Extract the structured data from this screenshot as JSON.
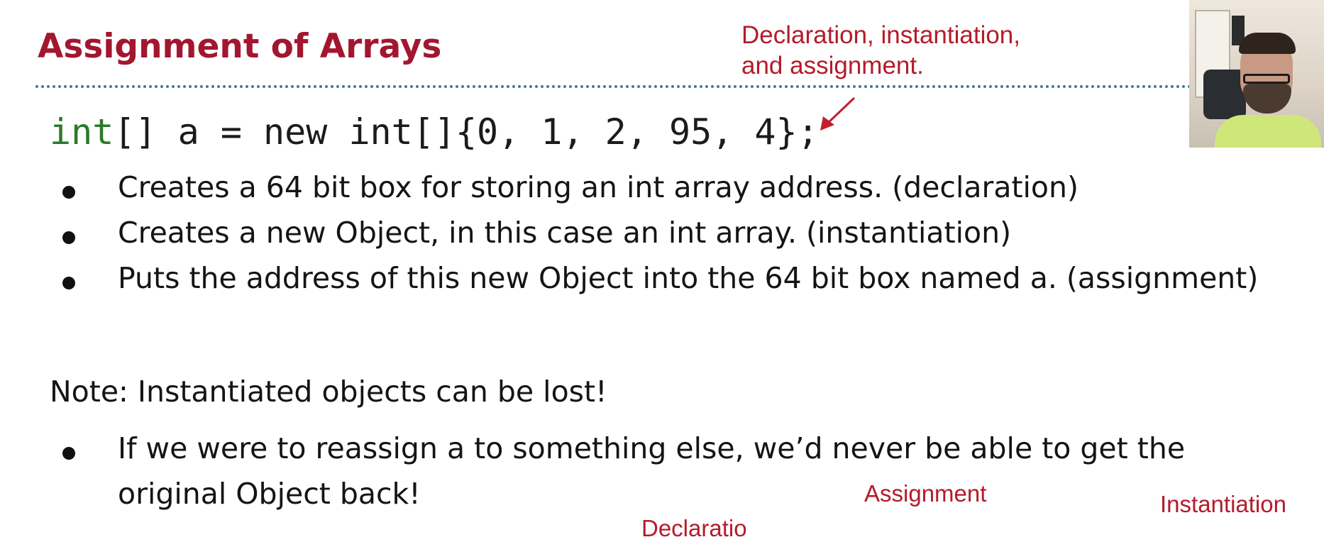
{
  "slide": {
    "title": "Assignment of Arrays",
    "annotation_top_line1": "Declaration, instantiation,",
    "annotation_top_line2": "and assignment.",
    "code": {
      "type_keyword": "int",
      "rest": "[] a = new int[]{0, 1, 2, 95, 4};"
    },
    "bullets": [
      "Creates a 64 bit box for storing an int array address. (declaration)",
      "Creates a new Object, in this case an int array. (instantiation)",
      "Puts the address of this new Object into the 64 bit box named a. (assignment)"
    ],
    "note": "Note: Instantiated objects can be lost!",
    "note_bullet_line1": "If we were to reassign a to something else, we’d never be able to get the",
    "note_bullet_line2": "original Object back!",
    "bottom_labels": {
      "assignment": "Assignment",
      "instantiation": "Instantiation",
      "declaration": "Declaratio"
    }
  },
  "colors": {
    "title": "#a3162f",
    "annotation": "#b41b2a",
    "code_keyword": "#2a7a2a",
    "divider": "#3f7a98"
  }
}
